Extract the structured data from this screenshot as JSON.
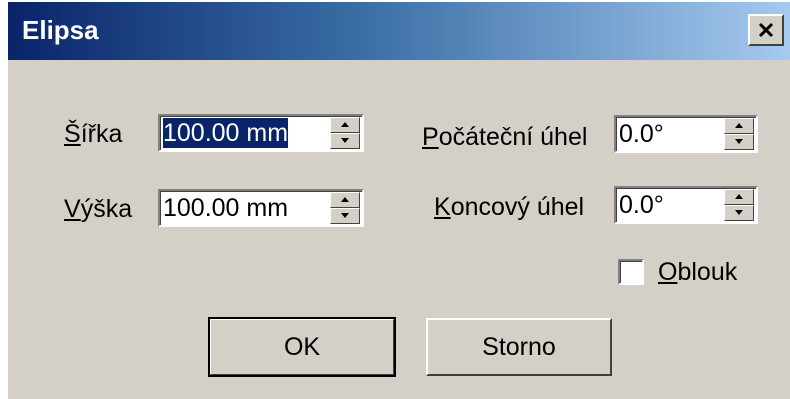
{
  "window": {
    "title": "Elipsa",
    "close_label": "×"
  },
  "fields": {
    "width": {
      "label_mnemonic": "Š",
      "label_rest": "ířka",
      "value": "100.00 mm"
    },
    "height": {
      "label_mnemonic": "V",
      "label_rest": "ýška",
      "value": "100.00 mm"
    },
    "start_angle": {
      "label_mnemonic": "P",
      "label_rest": "očáteční úhel",
      "value": "0.0°"
    },
    "end_angle": {
      "label_mnemonic": "K",
      "label_rest": "oncový úhel",
      "value": "0.0°"
    }
  },
  "arc": {
    "label_mnemonic": "O",
    "label_rest": "blouk",
    "checked": false
  },
  "buttons": {
    "ok": "OK",
    "cancel": "Storno"
  }
}
